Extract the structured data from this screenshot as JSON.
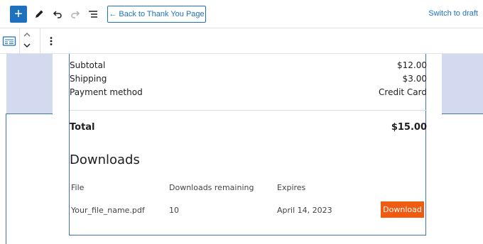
{
  "toolbar": {
    "add_icon": "plus-icon",
    "back_button_label": "← Back to Thank You Page",
    "switch_to_draft_label": "Switch to draft",
    "accent_color": "#1e72bd"
  },
  "order_summary": {
    "rows": [
      {
        "label": "Subtotal",
        "value": "$12.00"
      },
      {
        "label": "Shipping",
        "value": "$3.00"
      },
      {
        "label": "Payment method",
        "value": "Credit Card"
      }
    ],
    "total_label": "Total",
    "total_value": "$15.00"
  },
  "downloads": {
    "title": "Downloads",
    "columns": [
      "File",
      "Downloads remaining",
      "Expires"
    ],
    "rows": [
      {
        "file": "Your_file_name.pdf",
        "remaining": "10",
        "expires": "April 14, 2023",
        "action": "Download"
      }
    ],
    "button_color": "#f15a11"
  }
}
